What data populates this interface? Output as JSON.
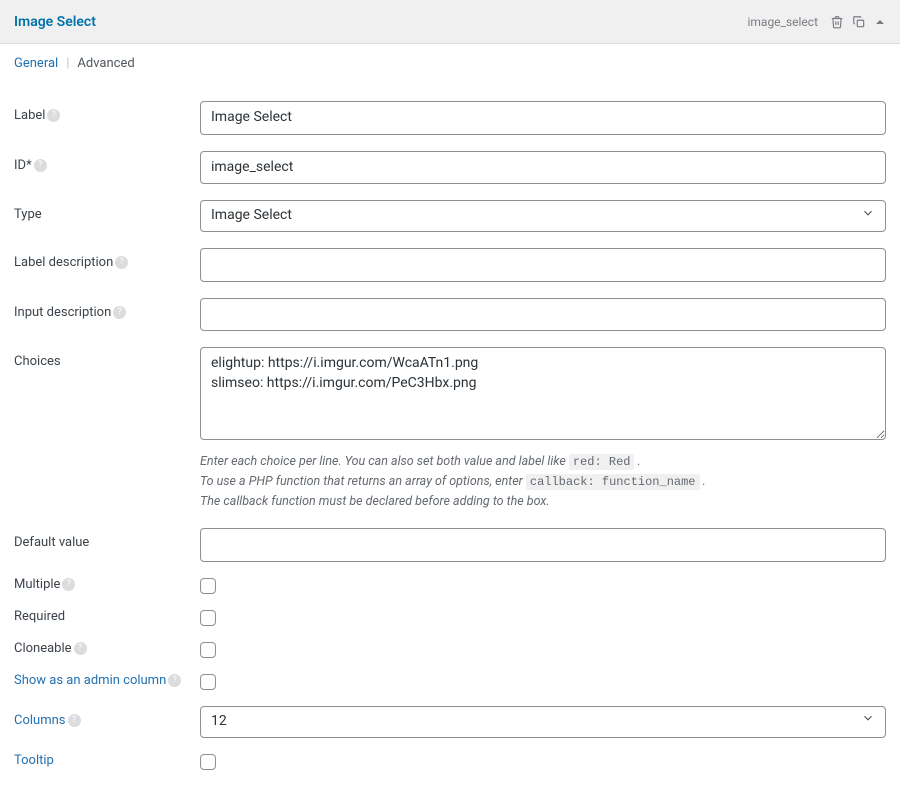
{
  "header": {
    "title": "Image Select",
    "slug": "image_select"
  },
  "tabs": {
    "general": "General",
    "advanced": "Advanced"
  },
  "fields": {
    "label": {
      "label": "Label",
      "value": "Image Select"
    },
    "id": {
      "label": "ID*",
      "value": "image_select"
    },
    "type": {
      "label": "Type",
      "value": "Image Select"
    },
    "label_desc": {
      "label": "Label description",
      "value": ""
    },
    "input_desc": {
      "label": "Input description",
      "value": ""
    },
    "choices": {
      "label": "Choices",
      "value": "elightup: https://i.imgur.com/WcaATn1.png\nslimseo: https://i.imgur.com/PeC3Hbx.png",
      "hint1": "Enter each choice per line. You can also set both value and label like ",
      "hint1_code": "red: Red",
      "hint2": "To use a PHP function that returns an array of options, enter ",
      "hint2_code": "callback: function_name",
      "hint3": "The callback function must be declared before adding to the box."
    },
    "default_value": {
      "label": "Default value",
      "value": ""
    },
    "multiple": {
      "label": "Multiple"
    },
    "required": {
      "label": "Required"
    },
    "cloneable": {
      "label": "Cloneable"
    },
    "admin_col": {
      "label": "Show as an admin column"
    },
    "columns": {
      "label": "Columns",
      "value": "12"
    },
    "tooltip": {
      "label": "Tooltip"
    }
  }
}
